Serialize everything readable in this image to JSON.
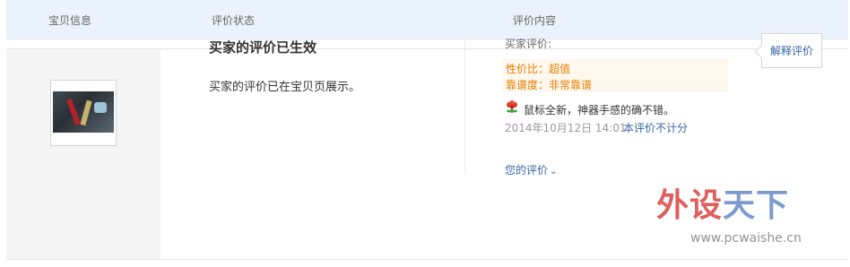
{
  "table_header": {
    "col_item": "宝贝信息",
    "col_status": "评价状态",
    "col_content": "评价内容"
  },
  "status": {
    "title": "买家的评价已生效",
    "description": "买家的评价已在宝贝页展示。"
  },
  "review": {
    "label": "买家评价:",
    "tag1": "性价比：超值",
    "tag2": "靠谱度：非常靠谱",
    "icon": "flower-icon",
    "text": "鼠标全新，神器手感的确不错。",
    "date": "2014年10月12日 14:01",
    "note": "本评价不计分",
    "your_review": "您的评价",
    "your_review_chevron": "⌄"
  },
  "actions": {
    "explain_label": "解释评价"
  },
  "watermark": {
    "text_a": "外设",
    "text_b": "天下",
    "url": "www.pcwaishe.cn"
  },
  "colors": {
    "header_bg": "#eaf2fb",
    "tag_color": "#e77d00",
    "link_color": "#3366aa"
  }
}
